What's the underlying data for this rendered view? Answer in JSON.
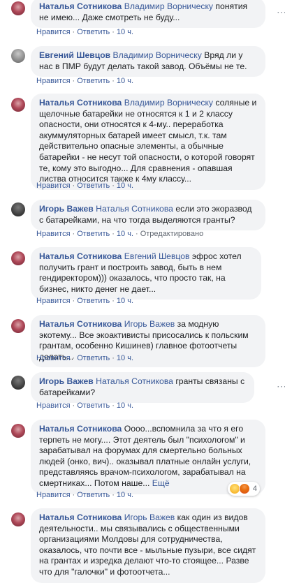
{
  "action_like": "Нравится",
  "action_reply": "Ответить",
  "action_edited": "Отредактировано",
  "separator": "·",
  "comments": [
    {
      "author": "Наталья Сотникова",
      "mention": "Владимир Ворническу",
      "text": " понятия не имею... Даже смотреть не буду...",
      "time": "10 ч."
    },
    {
      "author": "Евгений Шевцов",
      "mention": "Владимир Ворническу",
      "text": " Вряд ли у нас в ПМР будут делать такой завод. Объёмы не те.",
      "time": "10 ч."
    },
    {
      "author": "Наталья Сотникова",
      "mention": "Владимир Ворническу",
      "text": " соляные и щелочные батарейки не относятся к 1 и 2 классу опасности, они относятся к 4-му.. переработка акуммуляторных батарей имеет смысл, т.к. там действительно опасные элементы, а обычные батарейки - не несут той опасности, о которой говорят те, кому это выгодно... Для сравнения - опавшая листва относится также к 4му классу...",
      "time": "10 ч."
    },
    {
      "author": "Игорь Важев",
      "mention": "Наталья Сотникова",
      "text": " если это экоразвод с батарейками, на что тогда выделяются гранты?",
      "time": "10 ч."
    },
    {
      "author": "Наталья Сотникова",
      "mention": "Евгений Шевцов",
      "text": " эфрос хотел получить грант и построить завод, быть в нем гендиректором))) оказалось, что просто так, на бизнес, никто денег не дает...",
      "time": "10 ч."
    },
    {
      "author": "Наталья Сотникова",
      "mention": "Игорь Важев",
      "text": " за модную экотему... Все экоактивисты присосались к польским грантам, особенно Кишинев) главное фотоотчеты делать...",
      "time": "10 ч."
    },
    {
      "author": "Игорь Важев",
      "mention": "Наталья Сотникова",
      "text": " гранты связаны с батарейками?",
      "time": "10 ч."
    },
    {
      "author": "Наталья Сотникова",
      "mention": "",
      "text": " Оооо...вспомнила за что я его терпеть не могу.... Этот деятель был \"психологом\" и зарабатывал на форумах для смертельно больных людей (онко, вич).. оказывал платные онлайн услуги, представляясь врачом-психологом, зарабатывал на смертниках... Потом наше... ",
      "more": "Ещё",
      "time": "10 ч.",
      "reaction_count": "4"
    },
    {
      "author": "Наталья Сотникова",
      "mention": "Игорь Важев",
      "text": " как один из видов деятельности.. мы связывались с общественными организациями Молдовы для сотрудничества, оказалось, что почти все - мыльные пузыри, все сидят на грантах и изредка делают что-то стоящее... Разве что для \"галочки\" и фотоотчета...",
      "time": "10 ч."
    }
  ]
}
